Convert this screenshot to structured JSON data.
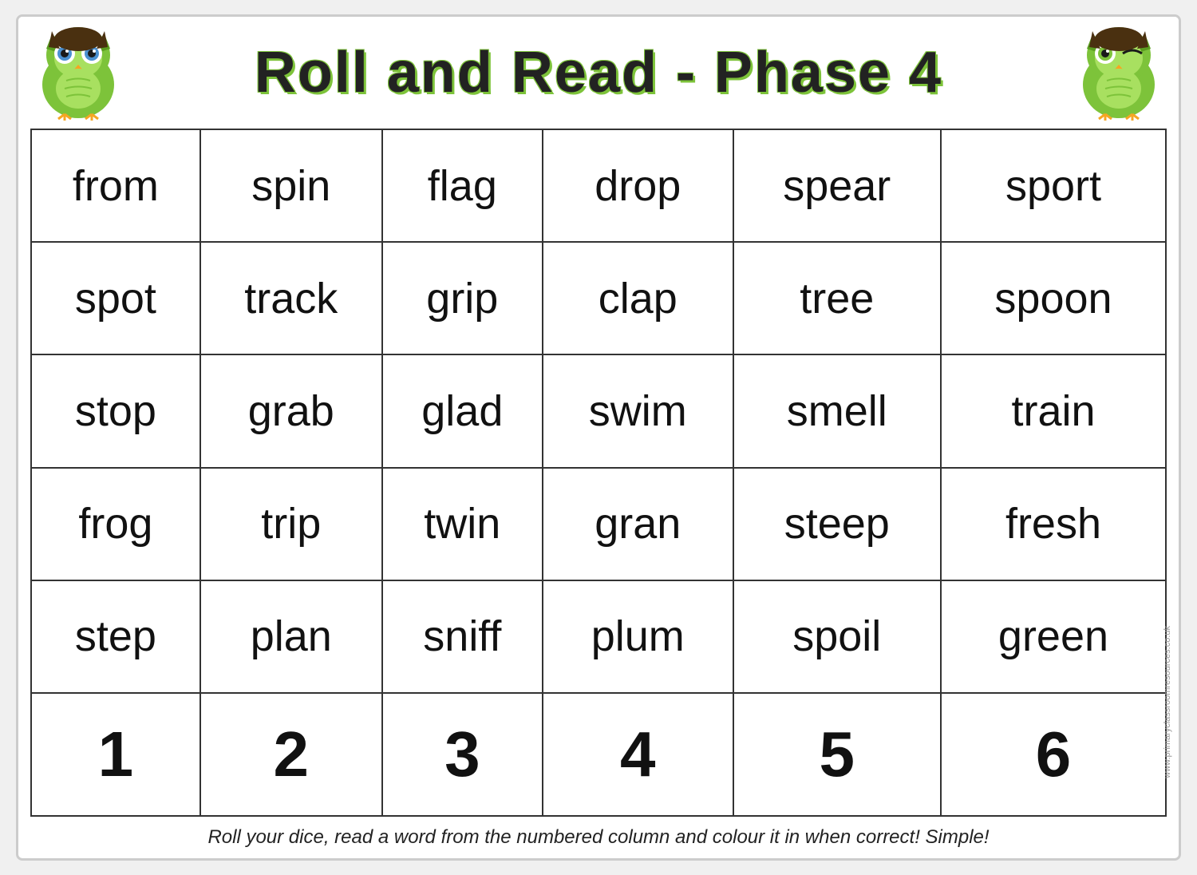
{
  "header": {
    "title": "Roll and Read - Phase 4"
  },
  "grid": {
    "rows": [
      [
        "from",
        "spin",
        "flag",
        "drop",
        "spear",
        "sport"
      ],
      [
        "spot",
        "track",
        "grip",
        "clap",
        "tree",
        "spoon"
      ],
      [
        "stop",
        "grab",
        "glad",
        "swim",
        "smell",
        "train"
      ],
      [
        "frog",
        "trip",
        "twin",
        "gran",
        "steep",
        "fresh"
      ],
      [
        "step",
        "plan",
        "sniff",
        "plum",
        "spoil",
        "green"
      ],
      [
        "1",
        "2",
        "3",
        "4",
        "5",
        "6"
      ]
    ]
  },
  "footer": {
    "text": "Roll your dice, read a word from the numbered column and colour it in when correct!  Simple!"
  },
  "watermark": "www.primaryclassroomresources.co.uk"
}
